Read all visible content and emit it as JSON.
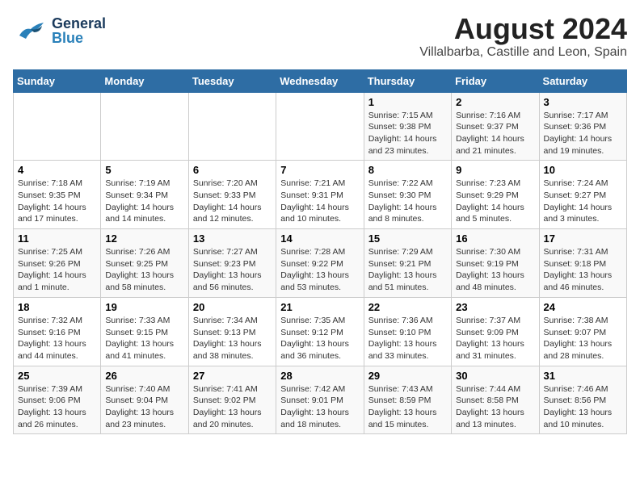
{
  "header": {
    "logo_general": "General",
    "logo_blue": "Blue",
    "title": "August 2024",
    "subtitle": "Villalbarba, Castille and Leon, Spain"
  },
  "days_of_week": [
    "Sunday",
    "Monday",
    "Tuesday",
    "Wednesday",
    "Thursday",
    "Friday",
    "Saturday"
  ],
  "weeks": [
    [
      {
        "num": "",
        "info": ""
      },
      {
        "num": "",
        "info": ""
      },
      {
        "num": "",
        "info": ""
      },
      {
        "num": "",
        "info": ""
      },
      {
        "num": "1",
        "info": "Sunrise: 7:15 AM\nSunset: 9:38 PM\nDaylight: 14 hours\nand 23 minutes."
      },
      {
        "num": "2",
        "info": "Sunrise: 7:16 AM\nSunset: 9:37 PM\nDaylight: 14 hours\nand 21 minutes."
      },
      {
        "num": "3",
        "info": "Sunrise: 7:17 AM\nSunset: 9:36 PM\nDaylight: 14 hours\nand 19 minutes."
      }
    ],
    [
      {
        "num": "4",
        "info": "Sunrise: 7:18 AM\nSunset: 9:35 PM\nDaylight: 14 hours\nand 17 minutes."
      },
      {
        "num": "5",
        "info": "Sunrise: 7:19 AM\nSunset: 9:34 PM\nDaylight: 14 hours\nand 14 minutes."
      },
      {
        "num": "6",
        "info": "Sunrise: 7:20 AM\nSunset: 9:33 PM\nDaylight: 14 hours\nand 12 minutes."
      },
      {
        "num": "7",
        "info": "Sunrise: 7:21 AM\nSunset: 9:31 PM\nDaylight: 14 hours\nand 10 minutes."
      },
      {
        "num": "8",
        "info": "Sunrise: 7:22 AM\nSunset: 9:30 PM\nDaylight: 14 hours\nand 8 minutes."
      },
      {
        "num": "9",
        "info": "Sunrise: 7:23 AM\nSunset: 9:29 PM\nDaylight: 14 hours\nand 5 minutes."
      },
      {
        "num": "10",
        "info": "Sunrise: 7:24 AM\nSunset: 9:27 PM\nDaylight: 14 hours\nand 3 minutes."
      }
    ],
    [
      {
        "num": "11",
        "info": "Sunrise: 7:25 AM\nSunset: 9:26 PM\nDaylight: 14 hours\nand 1 minute."
      },
      {
        "num": "12",
        "info": "Sunrise: 7:26 AM\nSunset: 9:25 PM\nDaylight: 13 hours\nand 58 minutes."
      },
      {
        "num": "13",
        "info": "Sunrise: 7:27 AM\nSunset: 9:23 PM\nDaylight: 13 hours\nand 56 minutes."
      },
      {
        "num": "14",
        "info": "Sunrise: 7:28 AM\nSunset: 9:22 PM\nDaylight: 13 hours\nand 53 minutes."
      },
      {
        "num": "15",
        "info": "Sunrise: 7:29 AM\nSunset: 9:21 PM\nDaylight: 13 hours\nand 51 minutes."
      },
      {
        "num": "16",
        "info": "Sunrise: 7:30 AM\nSunset: 9:19 PM\nDaylight: 13 hours\nand 48 minutes."
      },
      {
        "num": "17",
        "info": "Sunrise: 7:31 AM\nSunset: 9:18 PM\nDaylight: 13 hours\nand 46 minutes."
      }
    ],
    [
      {
        "num": "18",
        "info": "Sunrise: 7:32 AM\nSunset: 9:16 PM\nDaylight: 13 hours\nand 44 minutes."
      },
      {
        "num": "19",
        "info": "Sunrise: 7:33 AM\nSunset: 9:15 PM\nDaylight: 13 hours\nand 41 minutes."
      },
      {
        "num": "20",
        "info": "Sunrise: 7:34 AM\nSunset: 9:13 PM\nDaylight: 13 hours\nand 38 minutes."
      },
      {
        "num": "21",
        "info": "Sunrise: 7:35 AM\nSunset: 9:12 PM\nDaylight: 13 hours\nand 36 minutes."
      },
      {
        "num": "22",
        "info": "Sunrise: 7:36 AM\nSunset: 9:10 PM\nDaylight: 13 hours\nand 33 minutes."
      },
      {
        "num": "23",
        "info": "Sunrise: 7:37 AM\nSunset: 9:09 PM\nDaylight: 13 hours\nand 31 minutes."
      },
      {
        "num": "24",
        "info": "Sunrise: 7:38 AM\nSunset: 9:07 PM\nDaylight: 13 hours\nand 28 minutes."
      }
    ],
    [
      {
        "num": "25",
        "info": "Sunrise: 7:39 AM\nSunset: 9:06 PM\nDaylight: 13 hours\nand 26 minutes."
      },
      {
        "num": "26",
        "info": "Sunrise: 7:40 AM\nSunset: 9:04 PM\nDaylight: 13 hours\nand 23 minutes."
      },
      {
        "num": "27",
        "info": "Sunrise: 7:41 AM\nSunset: 9:02 PM\nDaylight: 13 hours\nand 20 minutes."
      },
      {
        "num": "28",
        "info": "Sunrise: 7:42 AM\nSunset: 9:01 PM\nDaylight: 13 hours\nand 18 minutes."
      },
      {
        "num": "29",
        "info": "Sunrise: 7:43 AM\nSunset: 8:59 PM\nDaylight: 13 hours\nand 15 minutes."
      },
      {
        "num": "30",
        "info": "Sunrise: 7:44 AM\nSunset: 8:58 PM\nDaylight: 13 hours\nand 13 minutes."
      },
      {
        "num": "31",
        "info": "Sunrise: 7:46 AM\nSunset: 8:56 PM\nDaylight: 13 hours\nand 10 minutes."
      }
    ]
  ]
}
